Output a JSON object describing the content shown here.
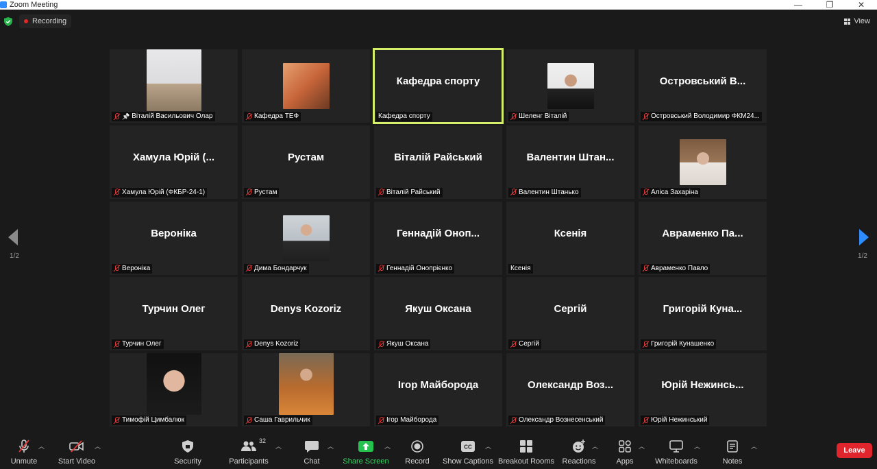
{
  "window": {
    "title": "Zoom Meeting",
    "minimize": "—",
    "restore": "❐",
    "close": "✕"
  },
  "topbar": {
    "recording_label": "Recording",
    "view_label": "View"
  },
  "pagination": {
    "prev_page": "1/2",
    "next_page": "1/2"
  },
  "participants": [
    {
      "big": "",
      "label": "Віталій Васильович Олар",
      "muted": true,
      "pinned": true,
      "photo": "classroom"
    },
    {
      "big": "",
      "label": "Кафедра ТЕФ",
      "muted": true,
      "pinned": false,
      "photo": "runner"
    },
    {
      "big": "Кафедра спорту",
      "label": "Кафедра спорту",
      "muted": false,
      "pinned": false,
      "photo": "",
      "active": true
    },
    {
      "big": "",
      "label": "Шеленг Віталій",
      "muted": true,
      "pinned": false,
      "photo": "man-suit"
    },
    {
      "big": "Островський В...",
      "label": "Островський Володимир ФКМ24...",
      "muted": true,
      "pinned": false,
      "photo": ""
    },
    {
      "big": "Хамула Юрій (...",
      "label": "Хамула Юрій (ФКБР-24-1)",
      "muted": true,
      "pinned": false,
      "photo": ""
    },
    {
      "big": "Рустам",
      "label": "Рустам",
      "muted": true,
      "pinned": false,
      "photo": ""
    },
    {
      "big": "Віталій Райський",
      "label": "Віталій Райський",
      "muted": true,
      "pinned": false,
      "photo": ""
    },
    {
      "big": "Валентин Штан...",
      "label": "Валентин Штанько",
      "muted": true,
      "pinned": false,
      "photo": ""
    },
    {
      "big": "",
      "label": "Аліса Захаріна",
      "muted": true,
      "pinned": false,
      "photo": "woman"
    },
    {
      "big": "Вероніка",
      "label": "Вероніка",
      "muted": true,
      "pinned": false,
      "photo": ""
    },
    {
      "big": "",
      "label": "Дима Бондарчук",
      "muted": true,
      "pinned": false,
      "photo": "young-man"
    },
    {
      "big": "Геннадій Оноп...",
      "label": "Геннадій Онопрієнко",
      "muted": true,
      "pinned": false,
      "photo": ""
    },
    {
      "big": "Ксенія",
      "label": "Ксенія",
      "muted": false,
      "pinned": false,
      "photo": ""
    },
    {
      "big": "Авраменко Па...",
      "label": "Авраменко Павло",
      "muted": true,
      "pinned": false,
      "photo": ""
    },
    {
      "big": "Турчин Олег",
      "label": "Турчин Олег",
      "muted": true,
      "pinned": false,
      "photo": ""
    },
    {
      "big": "Denys Kozoriz",
      "label": "Denys Kozoriz",
      "muted": true,
      "pinned": false,
      "photo": ""
    },
    {
      "big": "Якуш Оксана",
      "label": "Якуш Оксана",
      "muted": true,
      "pinned": false,
      "photo": ""
    },
    {
      "big": "Сергій",
      "label": "Сергій",
      "muted": true,
      "pinned": false,
      "photo": ""
    },
    {
      "big": "Григорій Куна...",
      "label": "Григорій Кунашенко",
      "muted": true,
      "pinned": false,
      "photo": ""
    },
    {
      "big": "",
      "label": "Тимофій Цимбалюк",
      "muted": true,
      "pinned": false,
      "photo": "smiling-man"
    },
    {
      "big": "",
      "label": "Саша Гаврильчик",
      "muted": true,
      "pinned": false,
      "photo": "woman-autumn"
    },
    {
      "big": "Ігор Майборода",
      "label": "Ігор Майборода",
      "muted": true,
      "pinned": false,
      "photo": ""
    },
    {
      "big": "Олександр Воз...",
      "label": "Олександр Вознесенський",
      "muted": true,
      "pinned": false,
      "photo": ""
    },
    {
      "big": "Юрій Нежинсь...",
      "label": "Юрій Нежинський",
      "muted": true,
      "pinned": false,
      "photo": ""
    }
  ],
  "toolbar": {
    "unmute": "Unmute",
    "start_video": "Start Video",
    "security": "Security",
    "participants": "Participants",
    "participants_count": "32",
    "chat": "Chat",
    "share_screen": "Share Screen",
    "record": "Record",
    "show_captions": "Show Captions",
    "breakout_rooms": "Breakout Rooms",
    "reactions": "Reactions",
    "apps": "Apps",
    "whiteboards": "Whiteboards",
    "notes": "Notes",
    "leave": "Leave"
  },
  "colors": {
    "accent_blue": "#2d8cff",
    "active_speaker": "#d6ef6a",
    "leave_red": "#e0252c",
    "share_green": "#3fd26a",
    "mute_red": "#e03a3a"
  }
}
